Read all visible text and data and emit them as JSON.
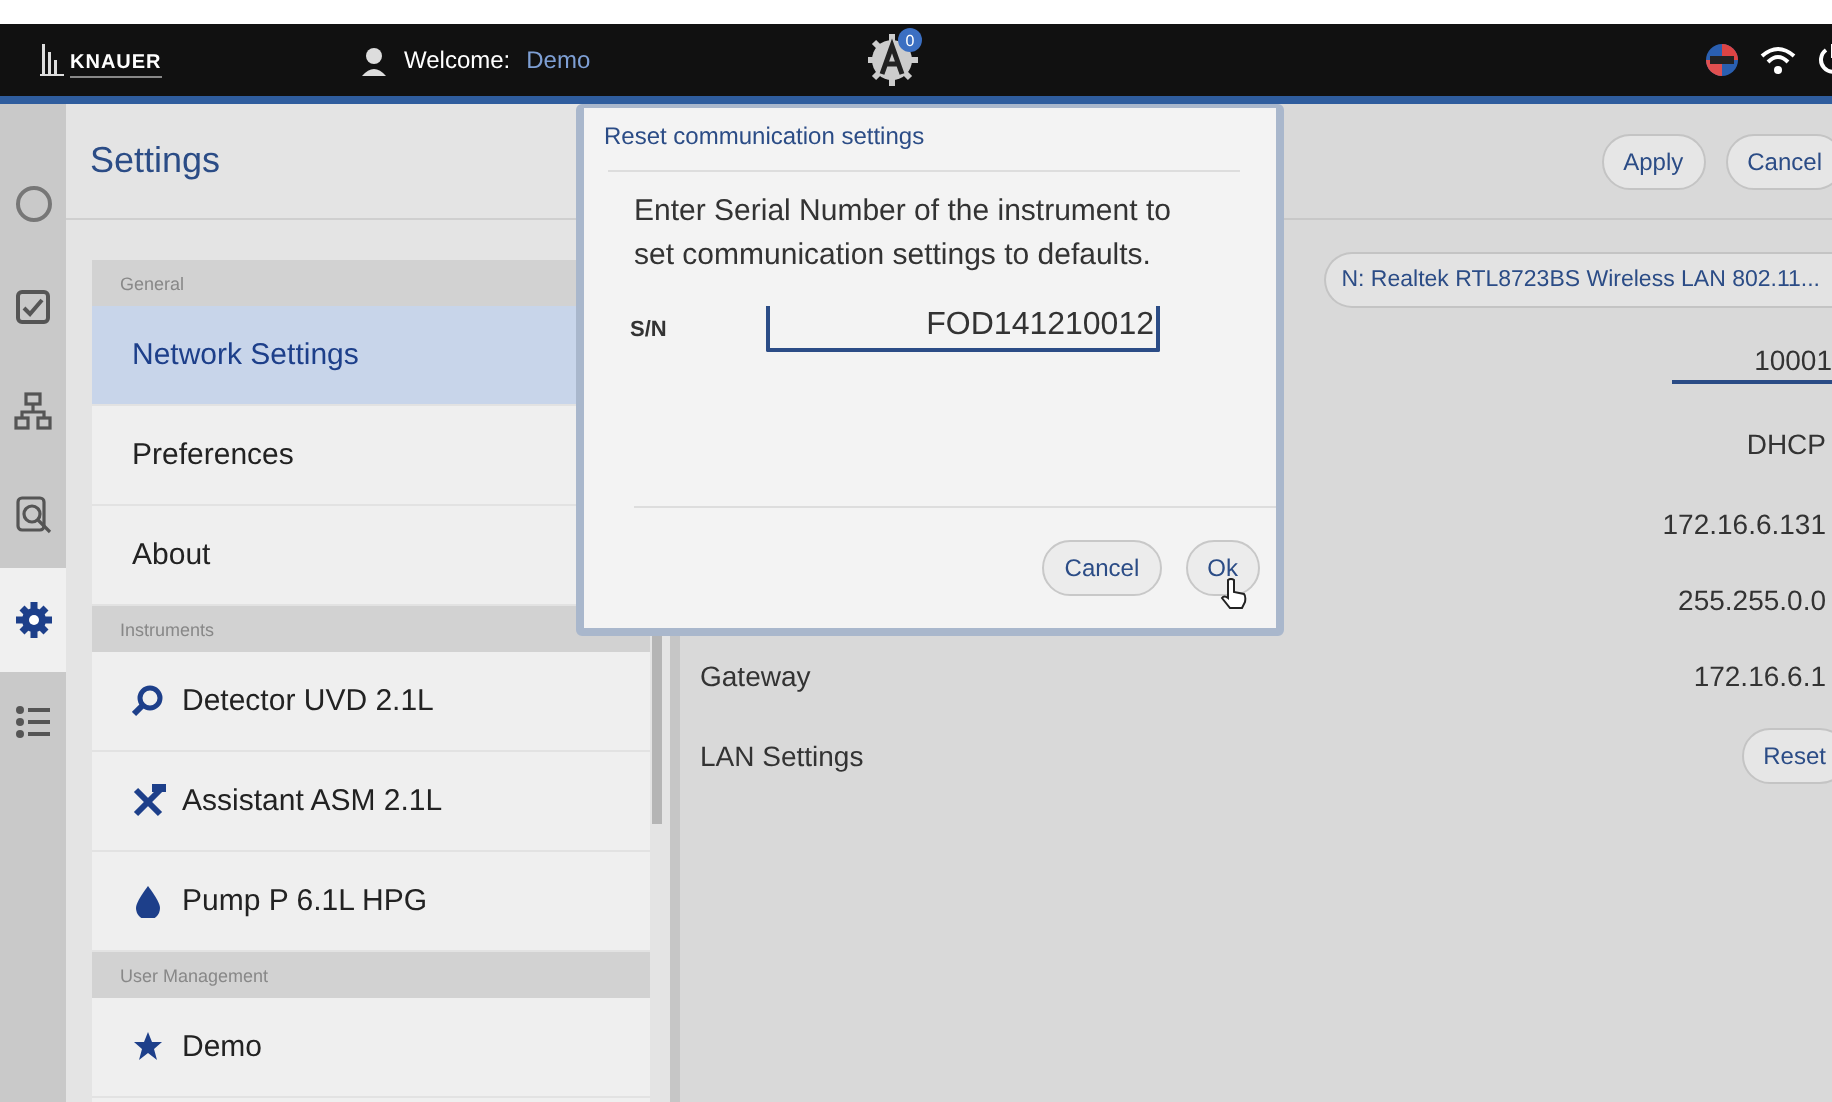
{
  "topbar": {
    "logo": "KNAUER",
    "welcome_label": "Welcome:",
    "user": "Demo",
    "badge": "0"
  },
  "rail": [
    {
      "kind": "circle",
      "selected": false
    },
    {
      "kind": "check",
      "selected": false
    },
    {
      "kind": "tree",
      "selected": false
    },
    {
      "kind": "inspect",
      "selected": false
    },
    {
      "kind": "gear",
      "selected": true
    },
    {
      "kind": "list",
      "selected": false
    }
  ],
  "settings": {
    "title": "Settings",
    "sections": [
      {
        "header": "General",
        "items": [
          {
            "label": "Network Settings",
            "kind": "plain",
            "selected": true
          },
          {
            "label": "Preferences",
            "kind": "plain",
            "selected": false
          },
          {
            "label": "About",
            "kind": "plain",
            "selected": false
          }
        ]
      },
      {
        "header": "Instruments",
        "items": [
          {
            "label": "Detector UVD 2.1L",
            "kind": "detector",
            "selected": false
          },
          {
            "label": "Assistant ASM 2.1L",
            "kind": "assistant",
            "selected": false
          },
          {
            "label": "Pump P 6.1L HPG",
            "kind": "pump",
            "selected": false
          }
        ]
      },
      {
        "header": "User Management",
        "items": [
          {
            "label": "Demo",
            "kind": "user",
            "selected": false
          }
        ]
      }
    ]
  },
  "network": {
    "buttons": [
      "Apply",
      "Cancel"
    ],
    "adapter": "N: Realtek RTL8723BS Wireless LAN 802.11...",
    "rows": [
      {
        "kind": "field",
        "value": "10001"
      },
      {
        "kind": "text",
        "value": "DHCP"
      },
      {
        "kind": "text",
        "value": "172.16.6.131"
      },
      {
        "kind": "text",
        "value": "255.255.0.0"
      },
      {
        "kind": "text",
        "label": "Gateway",
        "value": "172.16.6.1"
      },
      {
        "kind": "button",
        "label": "LAN Settings",
        "value": "Reset"
      }
    ]
  },
  "dialog": {
    "title": "Reset communication settings",
    "message": "Enter Serial Number of the instrument to set communication settings to defaults.",
    "field_label": "S/N",
    "value": "FOD141210012",
    "buttons": [
      "Cancel",
      "Ok"
    ]
  }
}
